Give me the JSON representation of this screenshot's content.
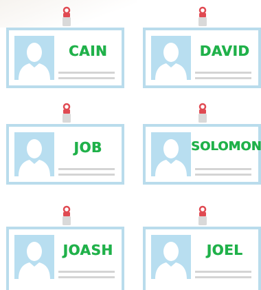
{
  "cards": [
    {
      "name": "CAIN"
    },
    {
      "name": "DAVID"
    },
    {
      "name": "JOB"
    },
    {
      "name": "SOLOMON"
    },
    {
      "name": "JOASH"
    },
    {
      "name": "JOEL"
    }
  ],
  "icons": {
    "badge_clip": "badge-clip-icon",
    "person": "person-silhouette-icon"
  },
  "colors": {
    "name_text": "#20b14a",
    "card_border": "#b9dcec",
    "photo_bg": "#b8def0",
    "clip_red": "#e04a52",
    "lines": "#d4d4d4"
  }
}
